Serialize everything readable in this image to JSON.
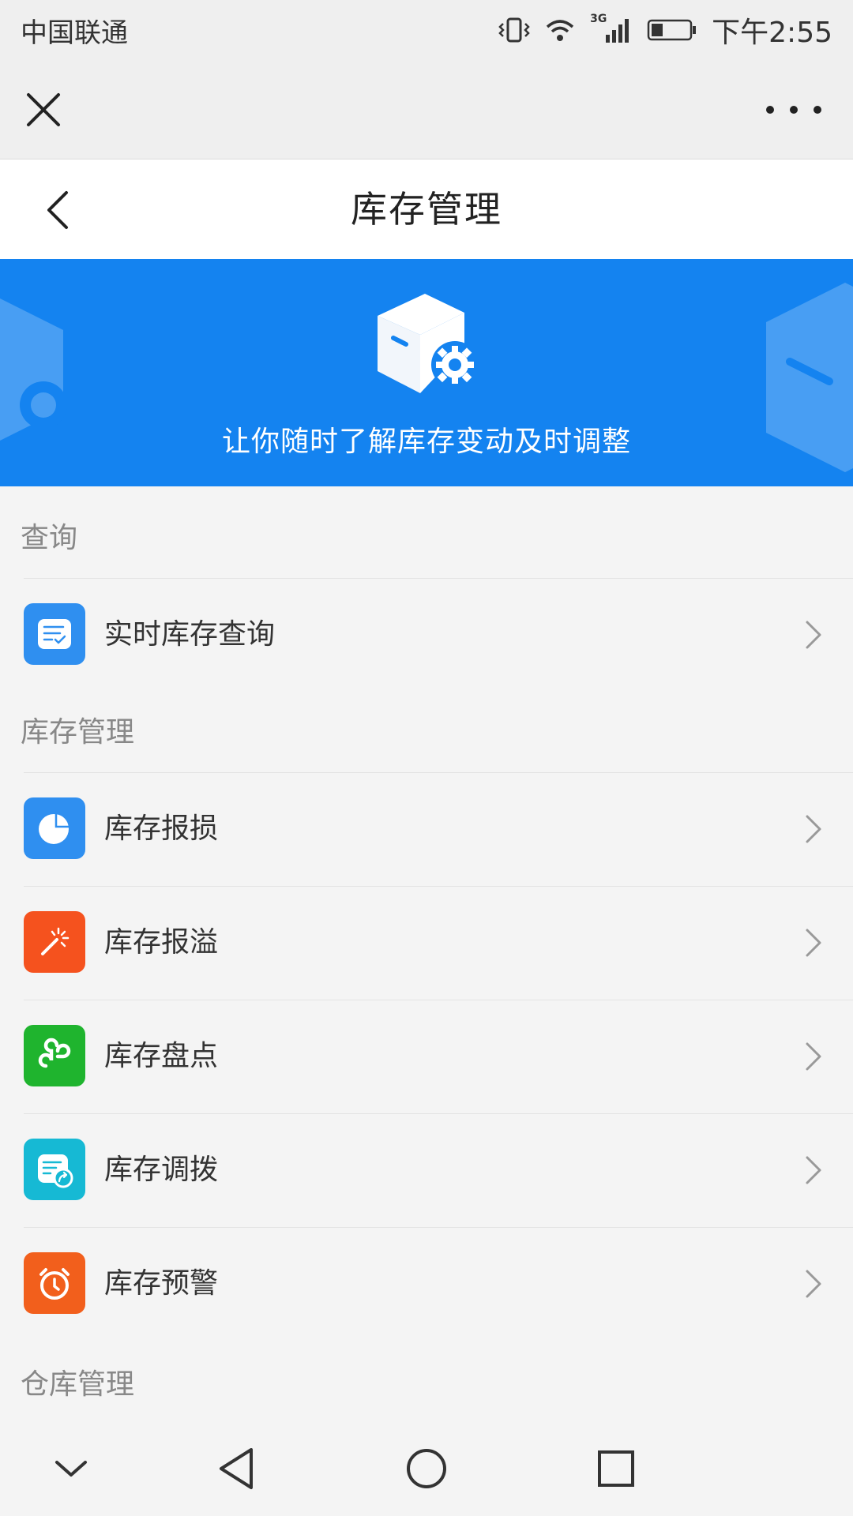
{
  "status_bar": {
    "carrier": "中国联通",
    "network": "3G",
    "time": "下午2:55",
    "icons": [
      "vibrate-icon",
      "wifi-icon",
      "signal-icon",
      "battery-icon"
    ]
  },
  "top_bar": {
    "close_icon": "close-icon",
    "more_icon": "more-icon"
  },
  "nav": {
    "title": "库存管理",
    "back_icon": "back-arrow-icon"
  },
  "banner": {
    "text": "让你随时了解库存变动及时调整",
    "background_color": "#1483f0",
    "icon": "box-gear-icon"
  },
  "sections": [
    {
      "title": "查询",
      "items": [
        {
          "label": "实时库存查询",
          "icon": "checklist-icon",
          "color": "#2f8ff0"
        }
      ]
    },
    {
      "title": "库存管理",
      "items": [
        {
          "label": "库存报损",
          "icon": "pie-chart-icon",
          "color": "#2f8ff0"
        },
        {
          "label": "库存报溢",
          "icon": "magic-wand-icon",
          "color": "#f5521e"
        },
        {
          "label": "库存盘点",
          "icon": "link-icon",
          "color": "#1fb42e"
        },
        {
          "label": "库存调拨",
          "icon": "document-share-icon",
          "color": "#16b9d4"
        },
        {
          "label": "库存预警",
          "icon": "alarm-clock-icon",
          "color": "#f25f1c"
        }
      ]
    },
    {
      "title": "仓库管理",
      "items": []
    }
  ],
  "system_nav": {
    "icons": [
      "collapse-icon",
      "back-icon",
      "home-icon",
      "recents-icon"
    ]
  }
}
